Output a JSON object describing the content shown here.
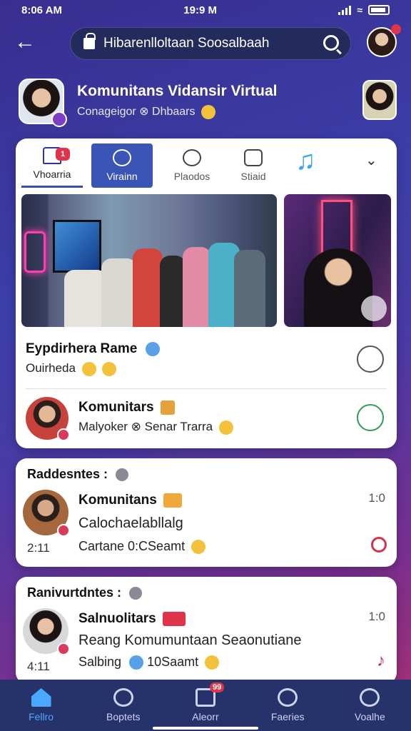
{
  "status": {
    "time": "8:06 AM",
    "center_time": "19:9 M"
  },
  "topbar": {
    "search_text": "Hibarenlloltaan Soosalbaah"
  },
  "community": {
    "title": "Komunitans Vidansir Virtual",
    "subtitle": "Conageigor ⊗ Dhbaars"
  },
  "tabs": [
    {
      "label": "Vhoarria",
      "badge": "1"
    },
    {
      "label": "Virainn"
    },
    {
      "label": "Plaodos"
    },
    {
      "label": "Stiaid"
    }
  ],
  "feed": {
    "item1": {
      "title": "Eypdirhera Rame",
      "subtitle": "Ouirheda"
    },
    "item2": {
      "title": "Komunitars",
      "subtitle": "Malyoker ⊗ Senar  Trarra"
    }
  },
  "section1": {
    "title": "Raddesntes :",
    "name": "Komunitans",
    "line1": "Calochaelabllalg",
    "line2": "Cartane  0:CSeamt",
    "time": "1:0",
    "date": "2:11"
  },
  "section2": {
    "title": "Ranivurtdntes :",
    "name": "Salnuolitars",
    "line1": "Reang Komumuntaan Seaonutiane",
    "line2": "Salbing",
    "line2_extra": "10Saamt",
    "time": "1:0",
    "date": "4:11"
  },
  "bottom_nav": [
    {
      "label": "Fellro",
      "icon": "home-icon"
    },
    {
      "label": "Boptets",
      "icon": "explore-icon"
    },
    {
      "label": "Aleorr",
      "icon": "notifications-icon",
      "badge": "99"
    },
    {
      "label": "Faeries",
      "icon": "search-icon"
    },
    {
      "label": "Voalhe",
      "icon": "profile-icon"
    }
  ],
  "colors": {
    "accent": "#3a55b6",
    "nav_bg": "#26326a",
    "active_nav": "#4aa8ff",
    "badge": "#e0344a"
  }
}
